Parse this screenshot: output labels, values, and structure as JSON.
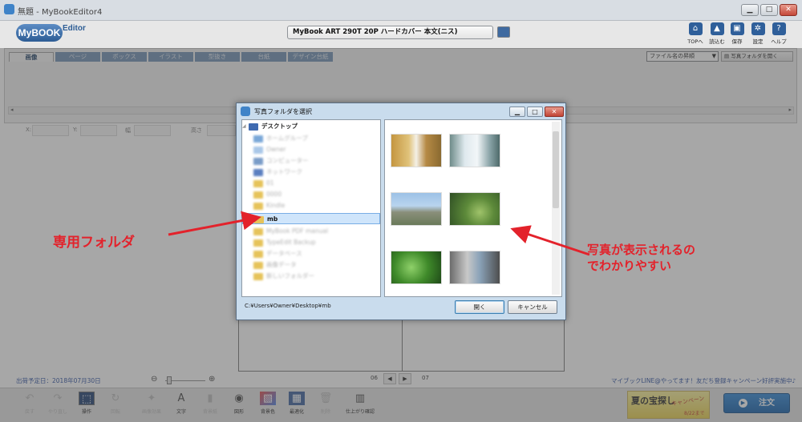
{
  "window": {
    "title": "無題 - MyBookEditor4",
    "controls": [
      "▁",
      "□",
      "✕"
    ]
  },
  "header": {
    "logo_main": "MyBOOK",
    "logo_sub": "Editor",
    "product_name": "MyBook ART 290T 20P ハードカバー 本文(ニス)",
    "toolbar": [
      {
        "label": "TOPへ",
        "icon": "home-icon"
      },
      {
        "label": "読込む",
        "icon": "load-icon"
      },
      {
        "label": "保存",
        "icon": "save-icon"
      },
      {
        "label": "設定",
        "icon": "gear-icon"
      },
      {
        "label": "ヘルプ",
        "icon": "help-icon"
      }
    ]
  },
  "tabs": [
    {
      "label": "画像",
      "active": true
    },
    {
      "label": "ページ"
    },
    {
      "label": "ボックス"
    },
    {
      "label": "イラスト"
    },
    {
      "label": "型抜き"
    },
    {
      "label": "台紙"
    },
    {
      "label": "デザイン台紙"
    }
  ],
  "sort_select": "ファイル名の昇順",
  "open_folder_label": "写真フォルダを開く",
  "props": {
    "x": "X:",
    "y": "Y:",
    "w": "幅",
    "h": "高さ"
  },
  "dialog": {
    "title": "写真フォルダを選択",
    "tree": [
      {
        "label": "デスクトップ",
        "type": "desktop"
      },
      {
        "label": "ホームグループ",
        "blur": true
      },
      {
        "label": "Owner",
        "blur": true
      },
      {
        "label": "コンピューター",
        "blur": true
      },
      {
        "label": "ネットワーク",
        "blur": true
      },
      {
        "label": "01",
        "blur": true
      },
      {
        "label": "0000",
        "blur": true
      },
      {
        "label": "Kindle",
        "blur": true
      },
      {
        "label": "mb",
        "selected": true
      },
      {
        "label": "MyBook PDF manual",
        "blur": true
      },
      {
        "label": "TypeEdit Backup",
        "blur": true
      },
      {
        "label": "データベース",
        "blur": true
      },
      {
        "label": "画像データ",
        "blur": true
      },
      {
        "label": "新しいフォルダー",
        "blur": true
      }
    ],
    "path": "C:¥Users¥Owner¥Desktop¥mb",
    "open_label": "開く",
    "cancel_label": "キャンセル"
  },
  "footer": {
    "ship_date": "出荷予定日：2018年07月30日",
    "page_left": "06",
    "page_right": "07",
    "line_info": "マイブックLINE@やってます！友だち登録キャンペーン好評実施中♪"
  },
  "bottom_toolbar": [
    {
      "label": "戻す",
      "icon": "undo-icon",
      "dim": true
    },
    {
      "label": "やり直し",
      "icon": "redo-icon",
      "dim": true
    },
    {
      "label": "操作",
      "icon": "cursor-icon",
      "selected": true
    },
    {
      "label": "回転",
      "icon": "rotate-icon",
      "dim": true
    },
    {
      "label": "画像効果",
      "icon": "effect-icon",
      "dim": true
    },
    {
      "label": "文字",
      "icon": "text-icon"
    },
    {
      "label": "背景紙",
      "icon": "paper-icon",
      "dim": true
    },
    {
      "label": "図形",
      "icon": "shape-icon"
    },
    {
      "label": "背景色",
      "icon": "bgcolor-icon"
    },
    {
      "label": "最適化",
      "icon": "optimize-icon"
    },
    {
      "label": "削除",
      "icon": "delete-icon",
      "dim": true
    },
    {
      "label": "仕上がり確認",
      "icon": "preview-icon"
    }
  ],
  "campaign": {
    "title": "夏の宝探し",
    "sub": "キャンペーン",
    "date": "8/22まで"
  },
  "order_label": "注文",
  "annotations": {
    "folder": "専用フォルダ",
    "photos_line1": "写真が表示されるの",
    "photos_line2": "でわかりやすい"
  },
  "colors": {
    "accent": "#2f5f9a",
    "annotation": "#e3222b",
    "order": "#1f74c4"
  }
}
